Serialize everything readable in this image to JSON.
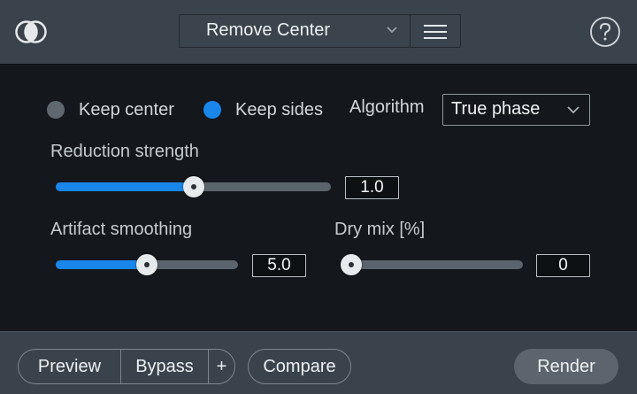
{
  "header": {
    "logo_icon": "overlapping-circles-icon",
    "preset_value": "Remove Center",
    "menu_icon": "hamburger-menu-icon",
    "help_icon": "question-mark-icon"
  },
  "mode": {
    "options": [
      {
        "label": "Keep center",
        "selected": false
      },
      {
        "label": "Keep sides",
        "selected": true
      }
    ],
    "algorithm_label": "Algorithm",
    "algorithm_value": "True phase"
  },
  "controls": {
    "reduction": {
      "label": "Reduction strength",
      "value": "1.0",
      "fraction": 0.5
    },
    "artifact": {
      "label": "Artifact smoothing",
      "value": "5.0",
      "fraction": 0.5
    },
    "drymix": {
      "label": "Dry mix [%]",
      "value": "0",
      "fraction": 0.0
    }
  },
  "footer": {
    "preview": "Preview",
    "bypass": "Bypass",
    "plus": "+",
    "compare": "Compare",
    "render": "Render"
  },
  "colors": {
    "accent": "#1a86ea",
    "inactive_radio": "#5f686f",
    "panel": "#14181c",
    "chrome": "#3a434c"
  }
}
